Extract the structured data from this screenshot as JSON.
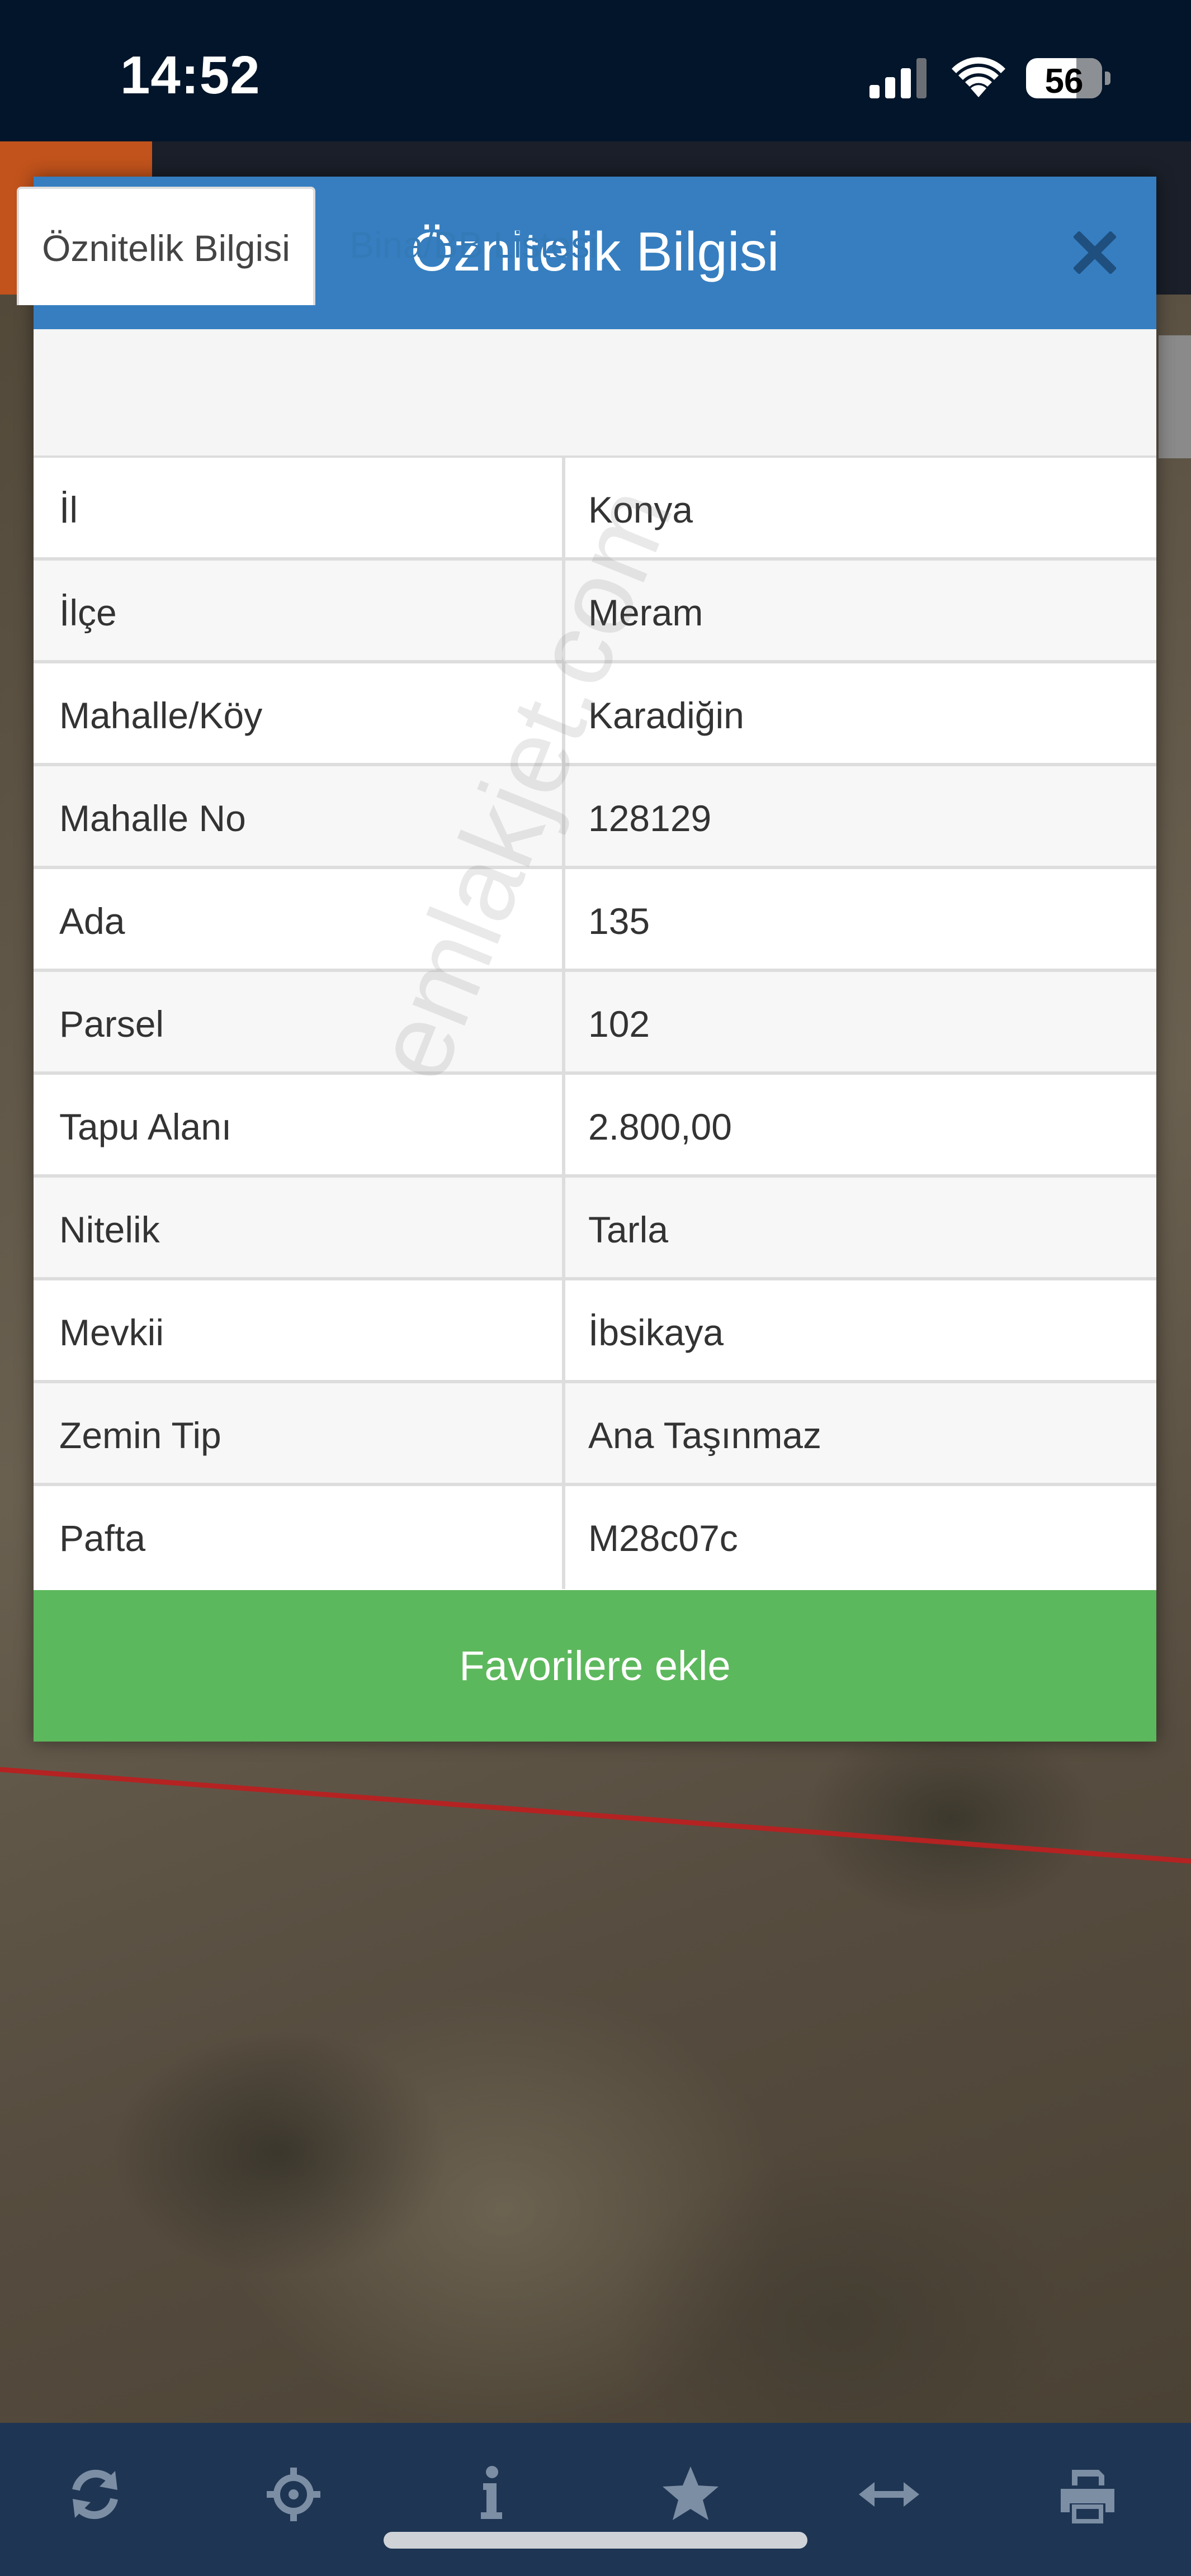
{
  "status_bar": {
    "time": "14:52",
    "battery_level": "56",
    "icons": [
      "cellular-signal-icon",
      "wifi-icon",
      "battery-icon"
    ]
  },
  "modal": {
    "title": "Öznitelik Bilgisi",
    "menu_icon": "vertical-dots-icon",
    "close_icon": "close-x-icon",
    "tabs": [
      {
        "label": "Öznitelik Bilgisi",
        "active": true
      },
      {
        "label": "Bina/BB Listesi",
        "active": false
      }
    ],
    "rows": [
      {
        "key": "İl",
        "value": "Konya"
      },
      {
        "key": "İlçe",
        "value": "Meram"
      },
      {
        "key": "Mahalle/Köy",
        "value": "Karadiğin"
      },
      {
        "key": "Mahalle No",
        "value": "128129"
      },
      {
        "key": "Ada",
        "value": "135"
      },
      {
        "key": "Parsel",
        "value": "102"
      },
      {
        "key": "Tapu Alanı",
        "value": "2.800,00"
      },
      {
        "key": "Nitelik",
        "value": "Tarla"
      },
      {
        "key": "Mevkii",
        "value": "İbsikaya"
      },
      {
        "key": "Zemin Tip",
        "value": "Ana Taşınmaz"
      },
      {
        "key": "Pafta",
        "value": "M28c07c"
      }
    ],
    "favorite_button_label": "Favorilere ekle",
    "watermark": "emlakjet.com"
  },
  "toolbar": {
    "buttons": [
      {
        "name": "refresh-icon"
      },
      {
        "name": "locate-crosshair-icon"
      },
      {
        "name": "info-icon"
      },
      {
        "name": "star-icon"
      },
      {
        "name": "measure-arrows-icon"
      },
      {
        "name": "print-icon"
      }
    ]
  },
  "colors": {
    "header_blue": "#367ec0",
    "tab_link_blue": "#337ab7",
    "favorite_green": "#5cb85c",
    "toolbar_navy": "#1e3553",
    "status_bar_bg": "#03152a"
  }
}
